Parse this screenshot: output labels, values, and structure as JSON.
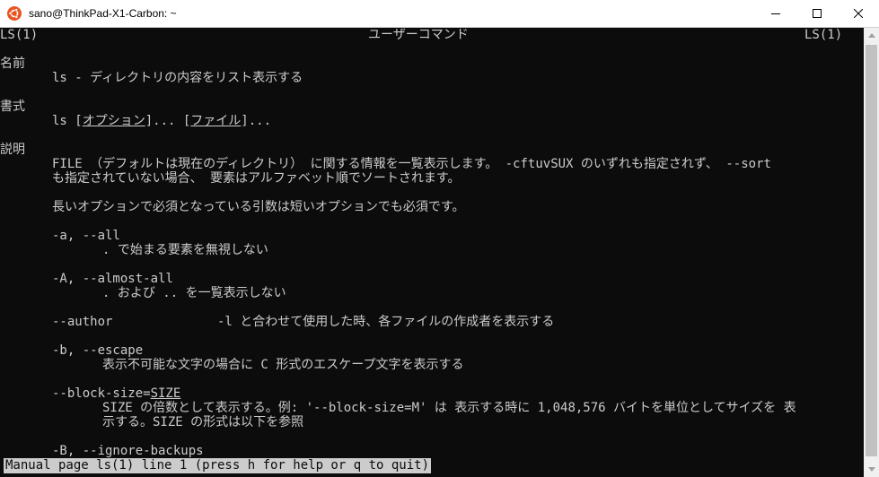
{
  "window": {
    "title": "sano@ThinkPad-X1-Carbon: ~",
    "accent": "#e95420"
  },
  "man": {
    "header_left": "LS(1)",
    "header_center": "ユーザーコマンド",
    "header_right": "LS(1)",
    "section_name": "名前",
    "name_line": "ls - ディレクトリの内容をリスト表示する",
    "section_synopsis": "書式",
    "synopsis_cmd": "ls",
    "synopsis_option": "オプション",
    "synopsis_file": "ファイル",
    "section_description": "説明",
    "desc_line1": "FILE （デフォルトは現在のディレクトリ） に関する情報を一覧表示します。 -cftuvSUX のいずれも指定されず、 --sort",
    "desc_line2": "も指定されていない場合、 要素はアルファベット順でソートされます。",
    "desc_line3": "長いオプションで必須となっている引数は短いオプションでも必須です。",
    "opt_a": "-a, --all",
    "opt_a_desc": ". で始まる要素を無視しない",
    "opt_A": "-A, --almost-all",
    "opt_A_desc": ". および .. を一覧表示しない",
    "opt_author": "--author",
    "opt_author_desc": "-l と合わせて使用した時、各ファイルの作成者を表示する",
    "opt_b": "-b, --escape",
    "opt_b_desc": "表示不可能な文字の場合に C 形式のエスケープ文字を表示する",
    "opt_bs_prefix": "--block-size=",
    "opt_bs_arg": "SIZE",
    "opt_bs_desc1": "SIZE の倍数として表示する。例: '--block-size=M' は 表示する時に 1,048,576 バイトを単位としてサイズを 表",
    "opt_bs_desc2": "示する。SIZE の形式は以下を参照",
    "opt_B": "-B, --ignore-backups"
  },
  "status": {
    "text": "Manual page ls(1) line 1 (press h for help or q to quit)"
  }
}
